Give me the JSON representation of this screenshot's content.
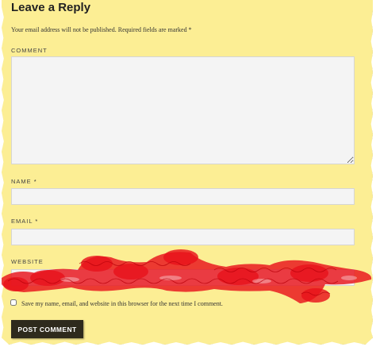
{
  "form": {
    "title": "Leave a Reply",
    "notes_text": "Your email address will not be published.",
    "notes_required": "Required fields are marked",
    "required_mark": "*",
    "comment_label": "COMMENT",
    "comment_value": "",
    "name_label": "NAME",
    "name_value": "",
    "email_label": "EMAIL",
    "email_value": "",
    "website_label": "WEBSITE",
    "website_value": "",
    "cookies_label": "Save my name, email, and website in this browser for the next time I comment.",
    "submit_label": "POST COMMENT"
  },
  "colors": {
    "paper": "#fcee94",
    "button": "#2e2a1d",
    "redaction": "#e8121b"
  }
}
